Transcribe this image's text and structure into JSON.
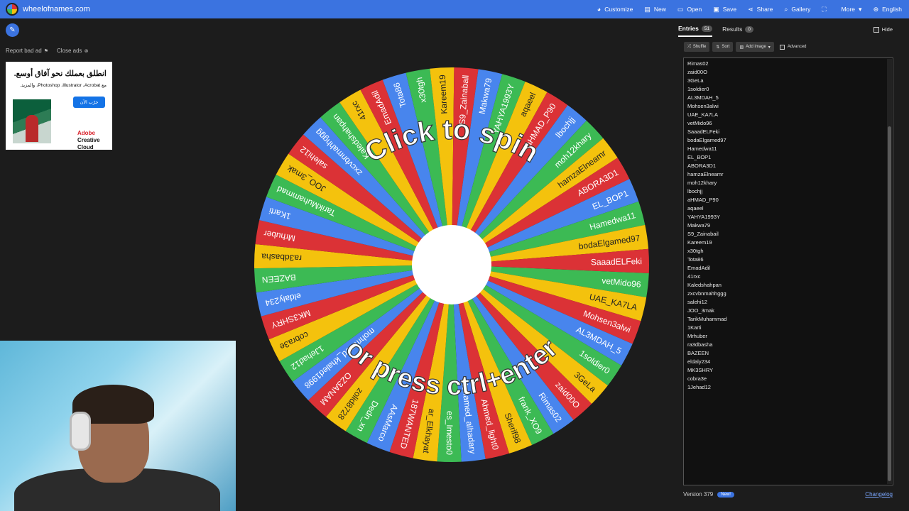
{
  "site": {
    "title": "wheelofnames.com"
  },
  "nav": [
    {
      "label": "Customize",
      "icon": "palette-icon",
      "glyph": "◕"
    },
    {
      "label": "New",
      "icon": "file-icon",
      "glyph": "▤"
    },
    {
      "label": "Open",
      "icon": "folder-icon",
      "glyph": "▭"
    },
    {
      "label": "Save",
      "icon": "save-icon",
      "glyph": "▣"
    },
    {
      "label": "Share",
      "icon": "share-icon",
      "glyph": "⋖"
    },
    {
      "label": "Gallery",
      "icon": "search-icon",
      "glyph": "⌕"
    },
    {
      "label": "",
      "icon": "fullscreen-icon",
      "glyph": "⛶"
    },
    {
      "label": "More",
      "icon": "chevron-down-icon",
      "glyph": "▾"
    },
    {
      "label": "English",
      "icon": "globe-icon",
      "glyph": "⊕"
    }
  ],
  "left": {
    "report_ad": "Report bad ad",
    "close_ads": "Close ads"
  },
  "ad": {
    "headline": "انطلق بعملك نحو آفاق أوسع.",
    "subline": "مع Photoshop ،Illustrator ،Acrobat، والمزيد.",
    "cta": "جرّب الآن",
    "brand_line1": "Adobe",
    "brand_line2": "Creative Cloud"
  },
  "wheel": {
    "top_text": "Click to spin",
    "bottom_text": "or press ctrl+enter",
    "colors": [
      "#3cba54",
      "#f4c20d",
      "#db3236",
      "#4885ed"
    ],
    "pointer_color": "#2fb84a",
    "segments": [
      "vetMido96",
      "UAE_KA7LA",
      "Mohsen3alwi",
      "AL3MDAH_5",
      "1soldier0",
      "3GeLa",
      "zaid00O",
      "Rimas02",
      "frank_XO9",
      "Sherif98",
      "Ahmed_light0",
      "Mohamed_alhadary",
      "es_Imesto0",
      "ar_Elkhayat",
      "187WANTED",
      "AAsMarco",
      "Dedn_xn",
      "zolid8728",
      "OZ3ANAM",
      "mohmmed_khaled1998",
      "1Jehad12",
      "cobra3e",
      "MK3SHRY",
      "eldaly234",
      "BAZEEN",
      "ra3dbasha",
      "Mrhuber",
      "1Karti",
      "TarikMuhammad",
      "JOO_3mak",
      "salehi12",
      "zxcvbnmahhggg",
      "Kaledshahpan",
      "41rxc",
      "EmadAdil",
      "Tota86",
      "x30tgh",
      "Kareem19",
      "S9_Zainaball",
      "Makwa79",
      "YAHYA1993Y",
      "aqaeel",
      "aHMAD_P90",
      "lbochjj",
      "moh12khary",
      "hamzaElneamr",
      "ABORA3D1",
      "EL_BOP1",
      "Hamedwa11",
      "bodaElgamed97",
      "SaaadELFeki"
    ]
  },
  "panel": {
    "tabs": [
      {
        "label": "Entries",
        "count": "51",
        "active": true
      },
      {
        "label": "Results",
        "count": "0",
        "active": false
      }
    ],
    "hide_label": "Hide",
    "toolbar": {
      "shuffle": "Shuffle",
      "sort": "Sort",
      "add_image": "Add image",
      "advanced": "Advanced"
    },
    "entries": [
      "Rimas02",
      "zaid00O",
      "3GeLa",
      "1soldier0",
      "AL3MDAH_5",
      "Mohsen3alwi",
      "UAE_KA7LA",
      "vetMido96",
      "SaaadELFeki",
      "bodaElgamed97",
      "Hamedwa11",
      "EL_BOP1",
      "ABORA3D1",
      "hamzaElneamr",
      "moh12khary",
      "lbochjj",
      "aHMAD_P90",
      "aqaeel",
      "YAHYA1993Y",
      "Makwa79",
      "S9_Zainabail",
      "Kareem19",
      "x30tgh",
      "Tota86",
      "EmadAdil",
      "41rxc",
      "Kaledshahpan",
      "zxcvbnmahhggg",
      "salehi12",
      "JOO_3mak",
      "TarikMuhammad",
      "1Karti",
      "Mrhuber",
      "ra3dbasha",
      "BAZEEN",
      "eldaly234",
      "MK3SHRY",
      "cobra3e",
      "1Jehad12"
    ],
    "version": "Version 379",
    "new_badge": "New!",
    "changelog": "Changelog"
  }
}
